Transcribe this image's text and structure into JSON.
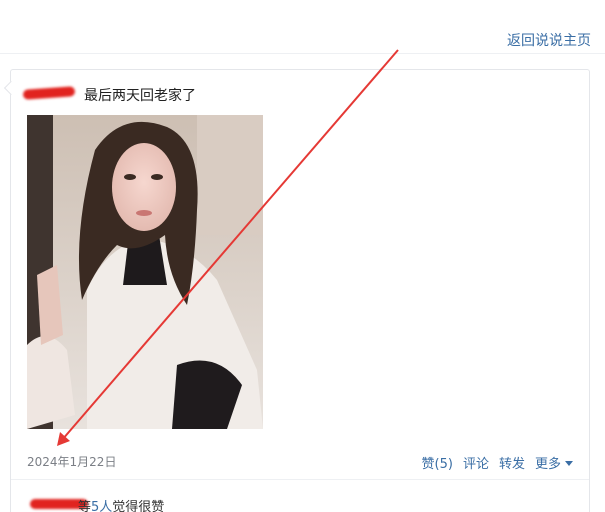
{
  "header": {
    "back_link": "返回说说主页"
  },
  "post": {
    "text": "最后两天回老家了",
    "date": "2024年1月22日",
    "actions": {
      "like": "赞(5)",
      "comment": "评论",
      "forward": "转发",
      "more": "更多"
    }
  },
  "likes": {
    "prefix": "等",
    "count": "5人",
    "suffix": "觉得很赞"
  },
  "annotation": {
    "arrow_color": "#e53935",
    "redaction_color": "#e1231f"
  }
}
